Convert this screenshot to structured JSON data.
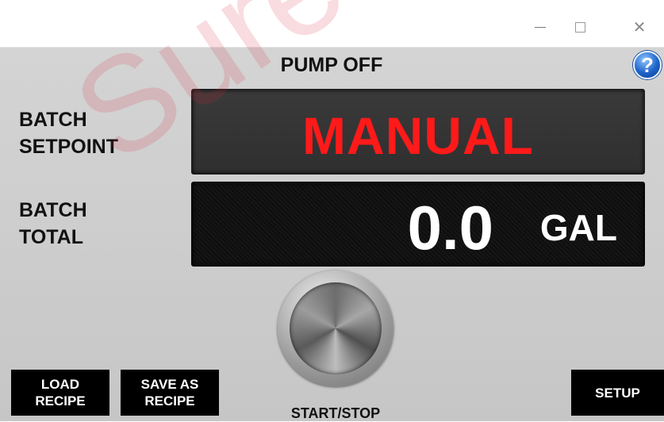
{
  "window": {
    "minimize_label": "—",
    "maximize_label": "☐",
    "close_label": "✕"
  },
  "header": {
    "status": "PUMP OFF",
    "help_label": "?"
  },
  "batch_setpoint": {
    "label_line1": "BATCH",
    "label_line2": "SETPOINT",
    "value": "MANUAL",
    "value_color": "#ff1a1a"
  },
  "batch_total": {
    "label_line1": "BATCH",
    "label_line2": "TOTAL",
    "value": "0.0",
    "unit": "GAL"
  },
  "controls": {
    "load_line1": "LOAD",
    "load_line2": "RECIPE",
    "save_line1": "SAVE AS",
    "save_line2": "RECIPE",
    "start_stop_label": "START/STOP",
    "setup_label": "SETUP"
  },
  "watermark": "SurePump"
}
